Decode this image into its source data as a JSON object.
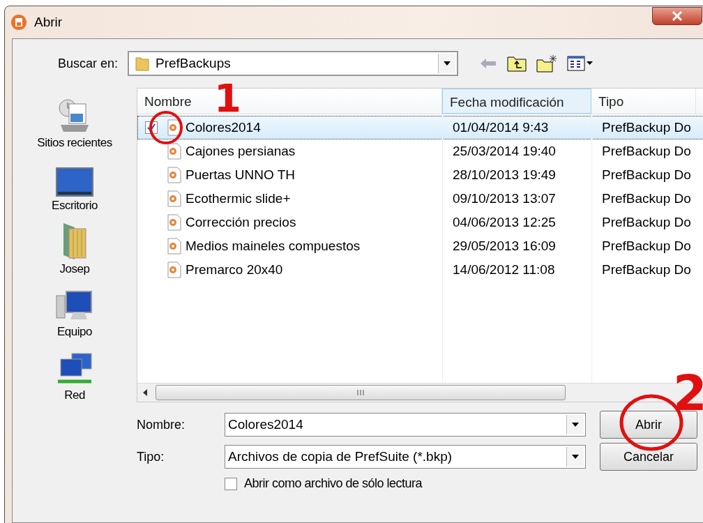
{
  "window": {
    "title": "Abrir"
  },
  "look_in": {
    "label": "Buscar en:",
    "value": "PrefBackups"
  },
  "places": [
    {
      "label": "Sitios recientes",
      "kind": "recent"
    },
    {
      "label": "Escritorio",
      "kind": "desktop"
    },
    {
      "label": "Josep",
      "kind": "user"
    },
    {
      "label": "Equipo",
      "kind": "computer"
    },
    {
      "label": "Red",
      "kind": "network"
    }
  ],
  "columns": [
    "Nombre",
    "Fecha modificación",
    "Tipo"
  ],
  "rows": [
    {
      "name": "Colores2014",
      "date": "01/04/2014 9:43",
      "type": "PrefBackup Do",
      "selected": true,
      "checked": true
    },
    {
      "name": "Cajones persianas",
      "date": "25/03/2014 19:40",
      "type": "PrefBackup Do",
      "selected": false,
      "checked": false
    },
    {
      "name": "Puertas UNNO TH",
      "date": "28/10/2013 19:49",
      "type": "PrefBackup Do",
      "selected": false,
      "checked": false
    },
    {
      "name": "Ecothermic slide+",
      "date": "09/10/2013 13:07",
      "type": "PrefBackup Do",
      "selected": false,
      "checked": false
    },
    {
      "name": "Corrección precios",
      "date": "04/06/2013 12:25",
      "type": "PrefBackup Do",
      "selected": false,
      "checked": false
    },
    {
      "name": "Medios maineles compuestos",
      "date": "29/05/2013 16:09",
      "type": "PrefBackup Do",
      "selected": false,
      "checked": false
    },
    {
      "name": "Premarco 20x40",
      "date": "14/06/2012 11:08",
      "type": "PrefBackup Do",
      "selected": false,
      "checked": false
    }
  ],
  "filename": {
    "label": "Nombre:",
    "value": "Colores2014"
  },
  "filetype": {
    "label": "Tipo:",
    "value": "Archivos de copia de PrefSuite (*.bkp)"
  },
  "readonly": {
    "label": "Abrir como archivo de sólo lectura",
    "checked": false
  },
  "buttons": [
    "Abrir",
    "Cancelar"
  ],
  "annotations": [
    "1",
    "2"
  ]
}
